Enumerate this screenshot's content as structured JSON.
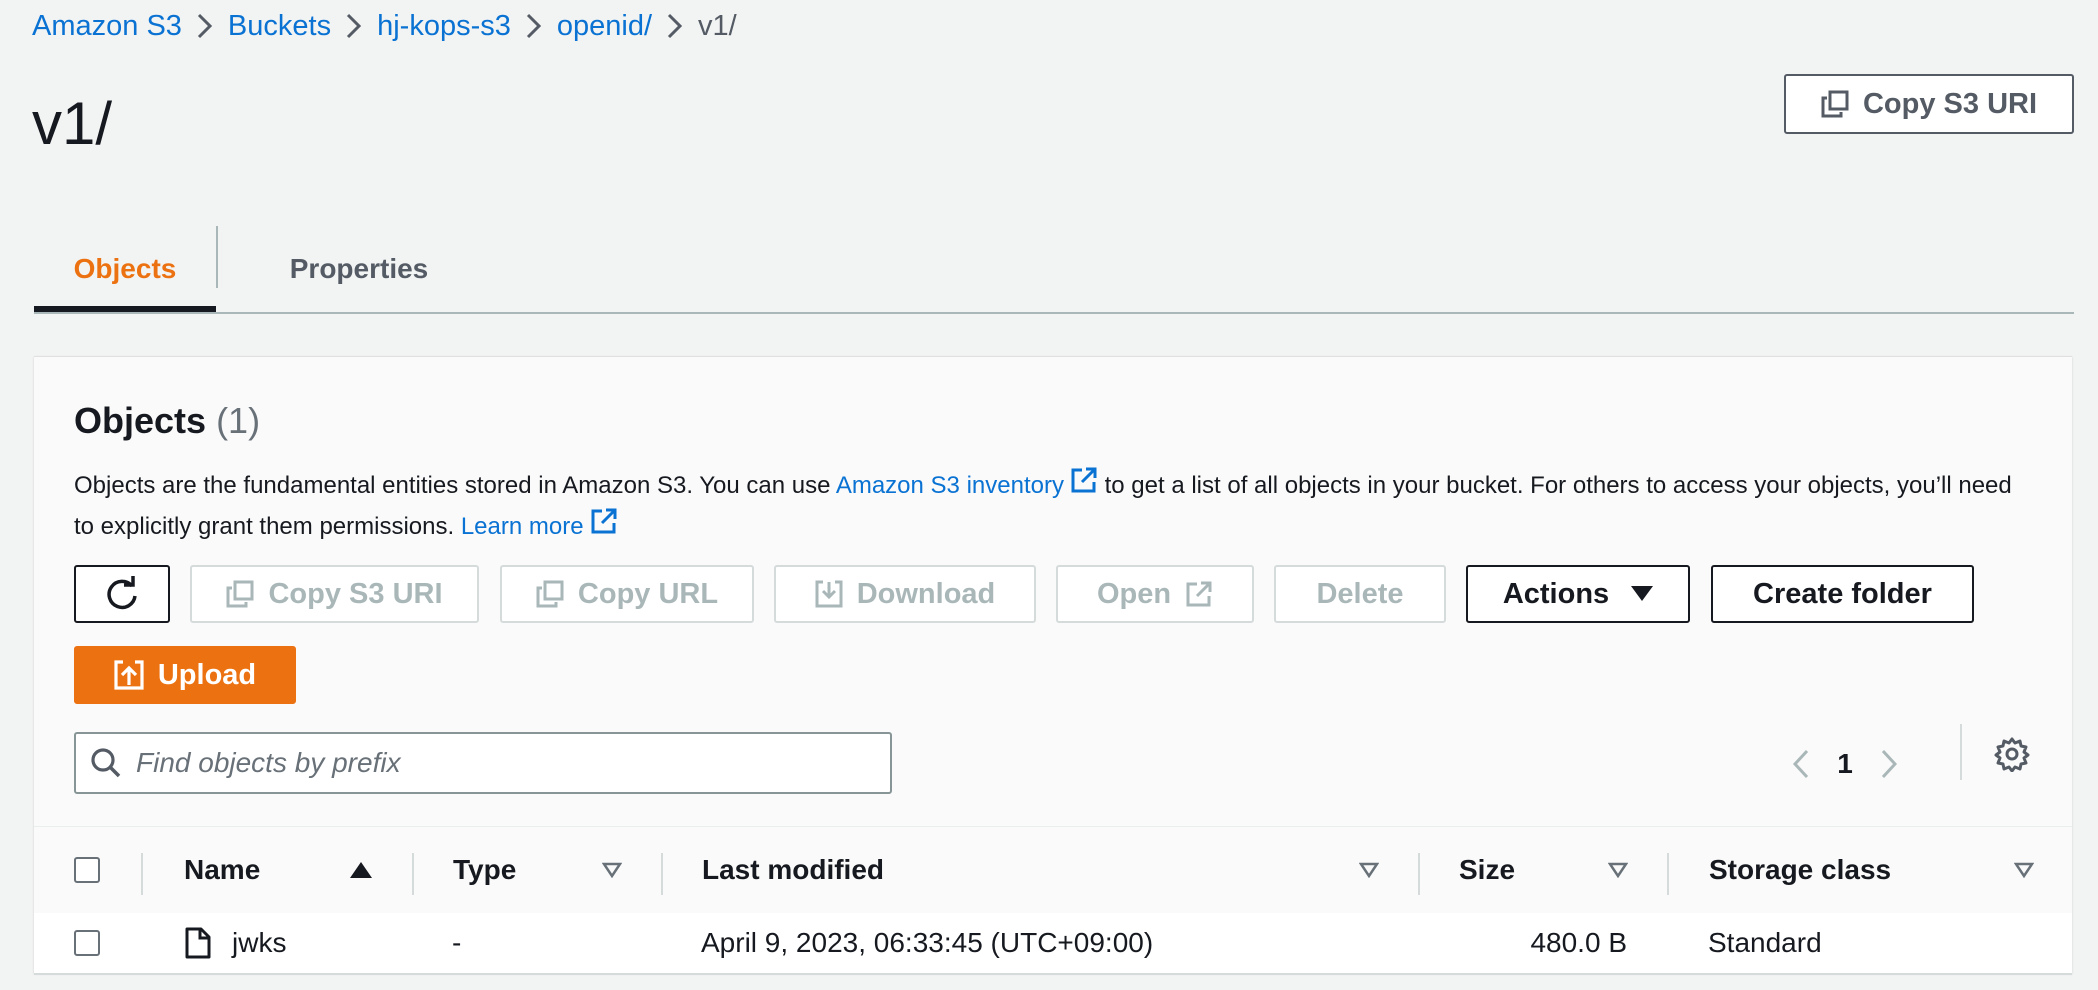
{
  "breadcrumb": [
    "Amazon S3",
    "Buckets",
    "hj-kops-s3",
    "openid/",
    "v1/"
  ],
  "page": {
    "title": "v1/",
    "copy_uri_label": "Copy S3 URI"
  },
  "tabs": [
    {
      "label": "Objects",
      "active": true
    },
    {
      "label": "Properties",
      "active": false
    }
  ],
  "objects": {
    "title": "Objects",
    "count": "(1)",
    "desc_part1": "Objects are the fundamental entities stored in Amazon S3. You can use ",
    "inventory_link": "Amazon S3 inventory",
    "desc_part2": " to get a list of all objects in your bucket. For others to access your objects, you’ll need to explicitly grant them permissions. ",
    "learn_more": "Learn more"
  },
  "toolbar": {
    "copy_s3_uri": "Copy S3 URI",
    "copy_url": "Copy URL",
    "download": "Download",
    "open": "Open",
    "delete": "Delete",
    "actions": "Actions",
    "create_folder": "Create folder",
    "upload": "Upload"
  },
  "search": {
    "placeholder": "Find objects by prefix",
    "value": ""
  },
  "pagination": {
    "current_page": "1"
  },
  "table": {
    "columns": [
      "Name",
      "Type",
      "Last modified",
      "Size",
      "Storage class"
    ],
    "rows": [
      {
        "name": "jwks",
        "type": "-",
        "last_modified": "April 9, 2023, 06:33:45 (UTC+09:00)",
        "size": "480.0 B",
        "storage_class": "Standard"
      }
    ]
  },
  "colors": {
    "link": "#0972d3",
    "accent": "#ec7211",
    "text": "#16191f",
    "muted": "#545b64",
    "disabled": "#aab7b8"
  }
}
